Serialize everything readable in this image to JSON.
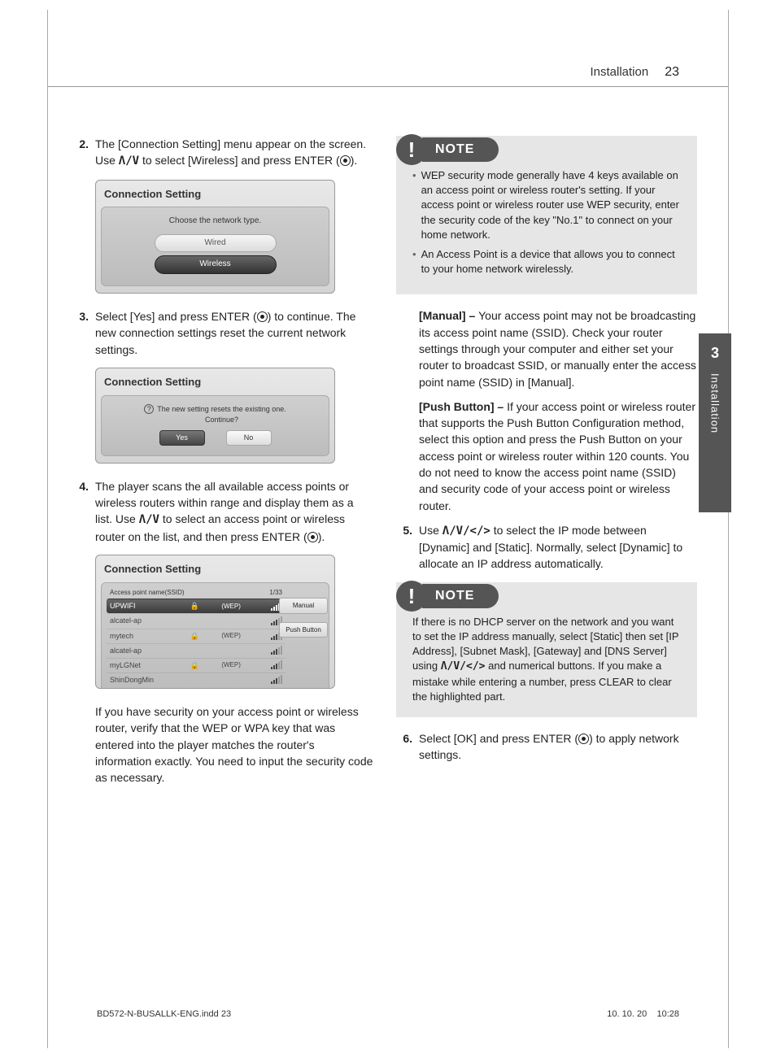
{
  "header": {
    "section": "Installation",
    "page": "23"
  },
  "side_tab": {
    "num": "3",
    "label": "Installation"
  },
  "step2": {
    "num": "2.",
    "text_a": "The [Connection Setting] menu appear on the screen. Use ",
    "arrows": "Λ/V",
    "text_b": " to select [Wireless] and press ENTER (",
    "text_c": ")."
  },
  "ss1": {
    "title": "Connection Setting",
    "label": "Choose the network type.",
    "wired": "Wired",
    "wireless": "Wireless"
  },
  "step3": {
    "num": "3.",
    "text_a": "Select [Yes] and press ENTER (",
    "text_b": ") to continue. The new connection settings reset the current network settings."
  },
  "ss2": {
    "title": "Connection Setting",
    "msg1": "The new setting resets the existing one.",
    "msg2": "Continue?",
    "yes": "Yes",
    "no": "No"
  },
  "step4": {
    "num": "4.",
    "text_a": "The player scans the all available access points or wireless routers within range and display them as a list. Use ",
    "arrows": "Λ/V",
    "text_b": " to select an access point or wireless router on the list, and then press ENTER (",
    "text_c": ")."
  },
  "ss3": {
    "title": "Connection Setting",
    "header_left": "Access point name(SSID)",
    "header_right": "1/33",
    "rows": [
      {
        "name": "UPWIFI",
        "lock": "🔒",
        "wep": "(WEP)",
        "sel": true
      },
      {
        "name": "alcatel-ap",
        "lock": "",
        "wep": "",
        "sel": false
      },
      {
        "name": "mytech",
        "lock": "🔒",
        "wep": "(WEP)",
        "sel": false
      },
      {
        "name": "alcatel-ap",
        "lock": "",
        "wep": "",
        "sel": false
      },
      {
        "name": "myLGNet",
        "lock": "🔒",
        "wep": "(WEP)",
        "sel": false
      },
      {
        "name": "ShinDongMin",
        "lock": "",
        "wep": "",
        "sel": false
      }
    ],
    "manual": "Manual",
    "push": "Push Button"
  },
  "post4": "If you have security on your access point or wireless router, verify that the WEP or WPA key that was entered into the player matches the router's information exactly. You need to input the security code as necessary.",
  "note1": {
    "label": "NOTE",
    "items": [
      "WEP security mode generally have 4 keys available on an access point or wireless router's setting. If your access point or wireless router use WEP security, enter the security code of the key \"No.1\" to connect on your home network.",
      "An Access Point is a device that allows you to connect to your home network wirelessly."
    ]
  },
  "manual_block": {
    "title": "[Manual] – ",
    "body": "Your access point may not be broadcasting its access point name (SSID). Check your router settings through your computer and either set your router to broadcast SSID, or manually enter the access point name (SSID) in [Manual]."
  },
  "push_block": {
    "title": "[Push Button] – ",
    "body": "If your access point or wireless router that supports the Push Button Configuration method, select this option and press the Push Button on your access point or wireless router within 120 counts. You do not need to know the access point name (SSID) and security code of your access point or wireless router."
  },
  "step5": {
    "num": "5.",
    "text_a": "Use ",
    "arrows": "Λ/V/</>",
    "text_b": " to select the IP mode between [Dynamic] and [Static]. Normally, select [Dynamic] to allocate an IP address automatically."
  },
  "note2": {
    "label": "NOTE",
    "body_a": "If there is no DHCP server on the network and you want to set the IP address manually, select [Static] then set [IP Address], [Subnet Mask], [Gateway] and [DNS Server] using ",
    "arrows": "Λ/V/</>",
    "body_b": " and numerical buttons. If you make a mistake while entering a number, press CLEAR to clear the highlighted part."
  },
  "step6": {
    "num": "6.",
    "text_a": "Select [OK] and press ENTER (",
    "text_b": ") to apply network settings."
  },
  "footer": {
    "file": "BD572-N-BUSALLK-ENG.indd   23",
    "date": "10. 10. 20",
    "time": "10:28"
  }
}
